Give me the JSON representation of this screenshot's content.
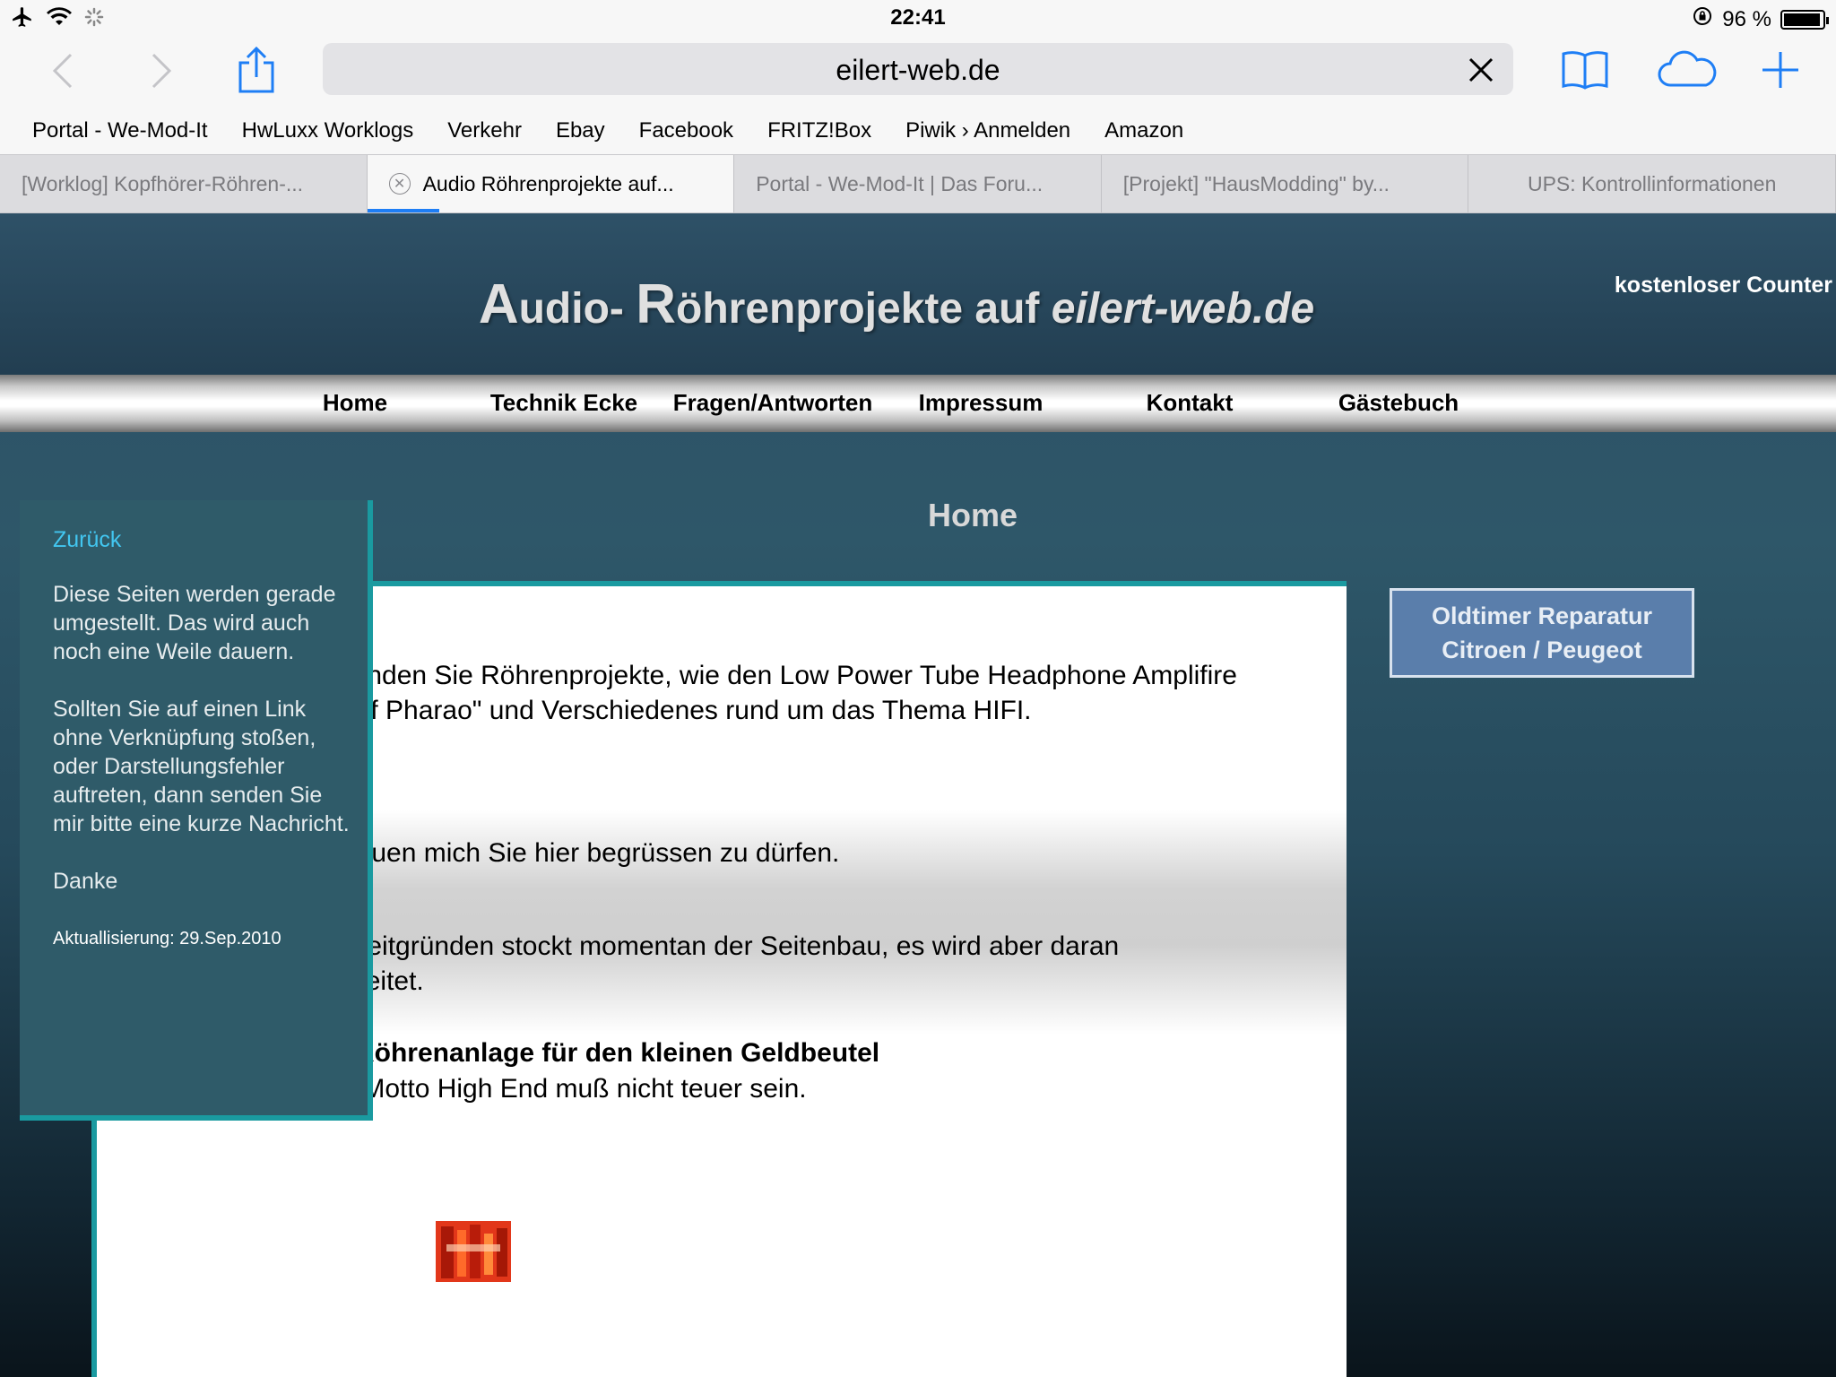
{
  "statusbar": {
    "time": "22:41",
    "battery": "96 %",
    "battery_level": 0.96
  },
  "browser": {
    "url": "eilert-web.de",
    "bookmarks": [
      "Portal - We-Mod-It",
      "HwLuxx Worklogs",
      "Verkehr",
      "Ebay",
      "Facebook",
      "FRITZ!Box",
      "Piwik › Anmelden",
      "Amazon"
    ],
    "tabs": [
      {
        "title": "[Worklog] Kopfhörer-Röhren-..."
      },
      {
        "title": "Audio Röhrenprojekte auf...",
        "active": true
      },
      {
        "title": "Portal - We-Mod-It | Das Foru..."
      },
      {
        "title": "[Projekt] \"HausModding\" by..."
      },
      {
        "title": "UPS: Kontrollinformationen"
      }
    ]
  },
  "site": {
    "title_a": "A",
    "title_b": "udio- ",
    "title_c": "R",
    "title_d": "öhrenprojekte auf ",
    "title_e": "eilert-web.de",
    "counter": "kostenloser Counter",
    "nav": [
      "Home",
      "Technik Ecke",
      "Fragen/Antworten",
      "Impressum",
      "Kontakt",
      "Gästebuch"
    ],
    "heading": "Home"
  },
  "sidebar": {
    "back": "Zurück",
    "p1": "Diese Seiten werden gerade umgestellt. Das wird auch noch eine Weile dauern.",
    "p2": "Sollten Sie auf einen Link ohne Verknüpfung stoßen, oder Darstellungsfehler auftreten, dann senden Sie mir bitte eine kurze Nachricht.",
    "p3": "Danke",
    "update": "Aktuallisierung: 29.Sep.2010"
  },
  "content": {
    "p1": "Hier finden Sie Röhrenprojekte, wie den Low Power Tube Headphone Amplifire \"Ear of Pharao\" und Verschiedenes rund um das Thema HIFI.",
    "p2": "Ich freuen mich Sie hier begrüssen zu dürfen.",
    "p3": "Aus Zeitgründen stockt momentan der Seitenbau, es wird aber daran gearbeitet.",
    "p4_title": "HiFi Röhrenanlage für den kleinen Geldbeutel",
    "p4_text": "Mein Motto High End muß nicht teuer sein."
  },
  "side_button": {
    "line1": "Oldtimer Reparatur",
    "line2": "Citroen / Peugeot"
  },
  "colors": {
    "accent": "#1e7ef5",
    "teal_border": "#1a9aa0",
    "sidebar_link": "#42c6f0"
  }
}
